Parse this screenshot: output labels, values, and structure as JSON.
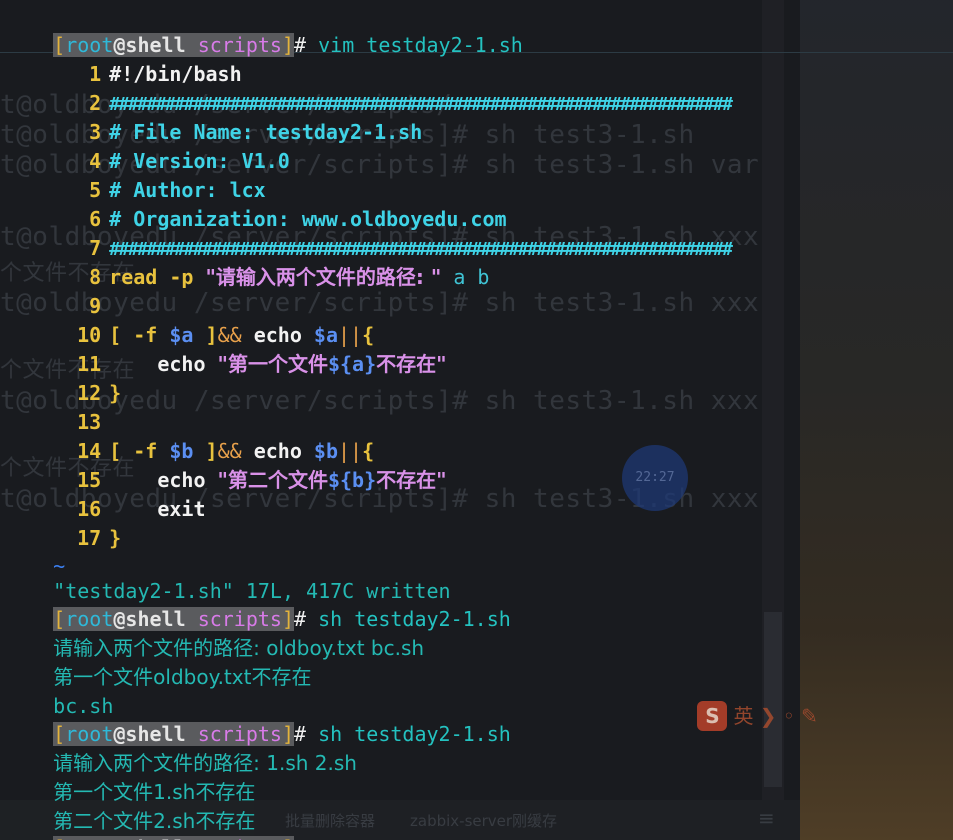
{
  "window": {
    "title": ""
  },
  "prompt": {
    "open": "[",
    "user": "root",
    "host": "@shell",
    "dir": "scripts",
    "close": "]",
    "symbol": "#"
  },
  "commands": {
    "vim": " vim testday2-1.sh",
    "run1": " sh testday2-1.sh",
    "run2": " sh testday2-1.sh"
  },
  "editor": {
    "line_numbers": [
      "1",
      "2",
      "3",
      "4",
      "5",
      "6",
      "7",
      "8",
      "9",
      "10",
      "11",
      "12",
      "13",
      "14",
      "15",
      "16",
      "17"
    ],
    "l1": "#!/bin/bash",
    "l2": "###################################################################",
    "l3": "# File Name: testday2-1.sh",
    "l4": "# Version: V1.0",
    "l5": "# Author: lcx",
    "l6": "# Organization: www.oldboyedu.com",
    "l7": "###################################################################",
    "l8_kw": "read -p ",
    "l8_str": "\"请输入两个文件的路径: \"",
    "l8_vars": " a b",
    "l10_a": "[ -f ",
    "l10_b": "$a",
    "l10_c": " ]",
    "l10_d": "&&",
    "l10_e": " echo ",
    "l10_f": "$a",
    "l10_g": "||",
    "l10_h": "{",
    "l11_a": "    echo ",
    "l11_b": "\"第一个文件",
    "l11_c": "${a}",
    "l11_d": "不存在\"",
    "l12": "}",
    "l14_a": "[ -f ",
    "l14_b": "$b",
    "l14_c": " ]",
    "l14_d": "&&",
    "l14_e": " echo ",
    "l14_f": "$b",
    "l14_g": "||",
    "l14_h": "{",
    "l15_a": "    echo ",
    "l15_b": "\"第二个文件",
    "l15_c": "${b}",
    "l15_d": "不存在\"",
    "l16": "    exit",
    "l17": "}",
    "tilde": "~",
    "status": "\"testday2-1.sh\" 17L, 417C written"
  },
  "output": {
    "run1": [
      "请输入两个文件的路径: oldboy.txt bc.sh",
      "第一个文件oldboy.txt不存在",
      "bc.sh"
    ],
    "run2": [
      "请输入两个文件的路径: 1.sh 2.sh",
      "第一个文件1.sh不存在",
      "第二个文件2.sh不存在"
    ]
  },
  "background_window": {
    "lines": [
      "t@oldboyedu /server/scripts/",
      "t@oldboyedu /server/scripts]# sh test3-1.sh",
      "t@oldboyedu /server/scripts]# sh test3-1.sh var",
      "t@oldboyedu /server/scripts]# sh test3-1.sh xxx",
      "个文件不存在",
      "t@oldboyedu /server/scripts]# sh test3-1.sh xxx",
      "个文件不存在",
      "t@oldboyedu /server/scripts]# sh test3-1.sh xxx",
      "个文件不存在",
      "t@oldboyedu /server/scripts]# sh test3-1.sh xxx"
    ],
    "bubble": "22:27",
    "ime_badge": "S",
    "ime_text": "英 ❯ ◦ ✎",
    "taskbar_items": [
      "批量删除容器",
      "zabbix-server刚缓存"
    ],
    "taskbar_menu": "≡"
  },
  "colors": {
    "background": "#191b1f",
    "line_number": "#e8c23e",
    "comment": "#3fd3e6",
    "string": "#d991e8",
    "variable": "#5b8ff2",
    "output": "#24b9b3"
  }
}
